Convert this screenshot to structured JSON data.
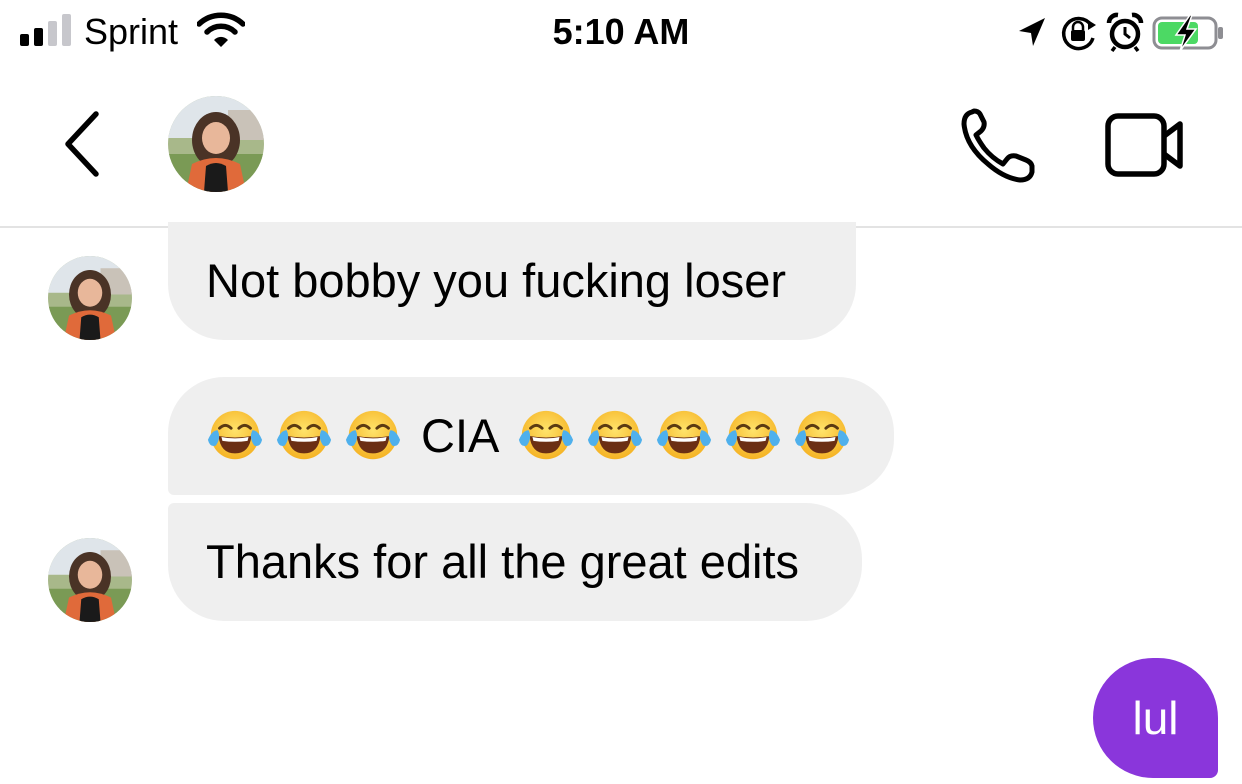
{
  "status_bar": {
    "carrier": "Sprint",
    "time": "5:10 AM",
    "signal_bars_active": 2,
    "signal_bars_total": 4,
    "battery_charging": true,
    "icons": [
      "signal-icon",
      "wifi-icon",
      "location-arrow-icon",
      "orientation-lock-icon",
      "alarm-icon",
      "battery-charging-icon"
    ]
  },
  "header": {
    "contact_name": "",
    "icons": [
      "back-chevron-icon",
      "phone-icon",
      "video-camera-icon"
    ]
  },
  "messages": [
    {
      "direction": "incoming",
      "text": "Not bobby you fucking loser",
      "show_avatar": true
    },
    {
      "direction": "incoming",
      "emoji_before": 3,
      "text": "CIA",
      "emoji_after": 5,
      "emoji_name": "face-with-tears-of-joy"
    },
    {
      "direction": "incoming",
      "text": "Thanks for all the great edits",
      "show_avatar": true
    },
    {
      "direction": "outgoing",
      "text": "lul"
    }
  ],
  "colors": {
    "incoming_bubble": "#efefef",
    "outgoing_bubble": "#8a36db",
    "battery_fill": "#4cd964",
    "signal_inactive": "#c7c7cc",
    "divider": "#e3e3e3"
  }
}
